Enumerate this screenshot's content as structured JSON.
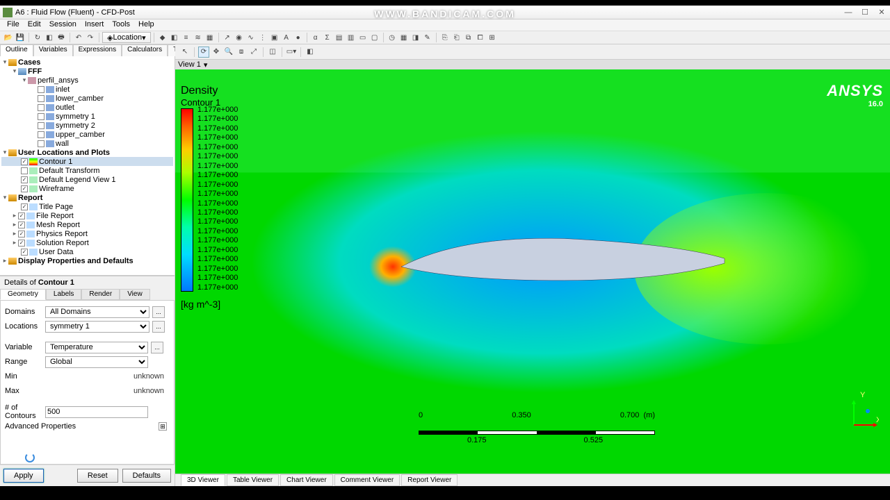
{
  "watermark": "WWW.BANDICAM.COM",
  "window": {
    "title": "A6 : Fluid Flow (Fluent) - CFD-Post"
  },
  "menu": {
    "file": "File",
    "edit": "Edit",
    "session": "Session",
    "insert": "Insert",
    "tools": "Tools",
    "help": "Help"
  },
  "toolbar": {
    "location_label": "Location"
  },
  "outline_tabs": {
    "outline": "Outline",
    "variables": "Variables",
    "expressions": "Expressions",
    "calculators": "Calculators",
    "turbo": "Turbo"
  },
  "tree": {
    "cases": "Cases",
    "fff": "FFF",
    "perfil": "perfil_ansys",
    "bcs": {
      "inlet": "inlet",
      "lower": "lower_camber",
      "outlet": "outlet",
      "sym1": "symmetry 1",
      "sym2": "symmetry 2",
      "upper": "upper_camber",
      "wall": "wall"
    },
    "userloc": "User Locations and Plots",
    "contour1": "Contour 1",
    "deftrans": "Default Transform",
    "deflegend": "Default Legend View 1",
    "wireframe": "Wireframe",
    "report": "Report",
    "titlepage": "Title Page",
    "filereport": "File Report",
    "meshreport": "Mesh Report",
    "physicsreport": "Physics Report",
    "solutionreport": "Solution Report",
    "userdata": "User Data",
    "display": "Display Properties and Defaults"
  },
  "details": {
    "title_prefix": "Details of ",
    "title_item": "Contour 1",
    "tabs": {
      "geometry": "Geometry",
      "labels": "Labels",
      "render": "Render",
      "view": "View"
    },
    "domains_lbl": "Domains",
    "domains_val": "All Domains",
    "locations_lbl": "Locations",
    "locations_val": "symmetry 1",
    "variable_lbl": "Variable",
    "variable_val": "Temperature",
    "range_lbl": "Range",
    "range_val": "Global",
    "min_lbl": "Min",
    "min_val": "unknown",
    "max_lbl": "Max",
    "max_val": "unknown",
    "contours_lbl": "# of Contours",
    "contours_val": "500",
    "advanced": "Advanced Properties",
    "apply": "Apply",
    "reset": "Reset",
    "defaults": "Defaults"
  },
  "view": {
    "tab": "View 1",
    "field": "Density",
    "subtitle": "Contour 1",
    "unit": "[kg m^-3]",
    "values": [
      "1.177e+000",
      "1.177e+000",
      "1.177e+000",
      "1.177e+000",
      "1.177e+000",
      "1.177e+000",
      "1.177e+000",
      "1.177e+000",
      "1.177e+000",
      "1.177e+000",
      "1.177e+000",
      "1.177e+000",
      "1.177e+000",
      "1.177e+000",
      "1.177e+000",
      "1.177e+000",
      "1.177e+000",
      "1.177e+000",
      "1.177e+000",
      "1.177e+000"
    ],
    "brand": "ANSYS",
    "ver": "16.0",
    "scale": {
      "t0": "0",
      "t1": "0.350",
      "t2": "0.700",
      "unit": "(m)",
      "m1": "0.175",
      "m2": "0.525"
    }
  },
  "viewer_tabs": {
    "v3d": "3D Viewer",
    "table": "Table Viewer",
    "chart": "Chart Viewer",
    "comment": "Comment Viewer",
    "report": "Report Viewer"
  }
}
